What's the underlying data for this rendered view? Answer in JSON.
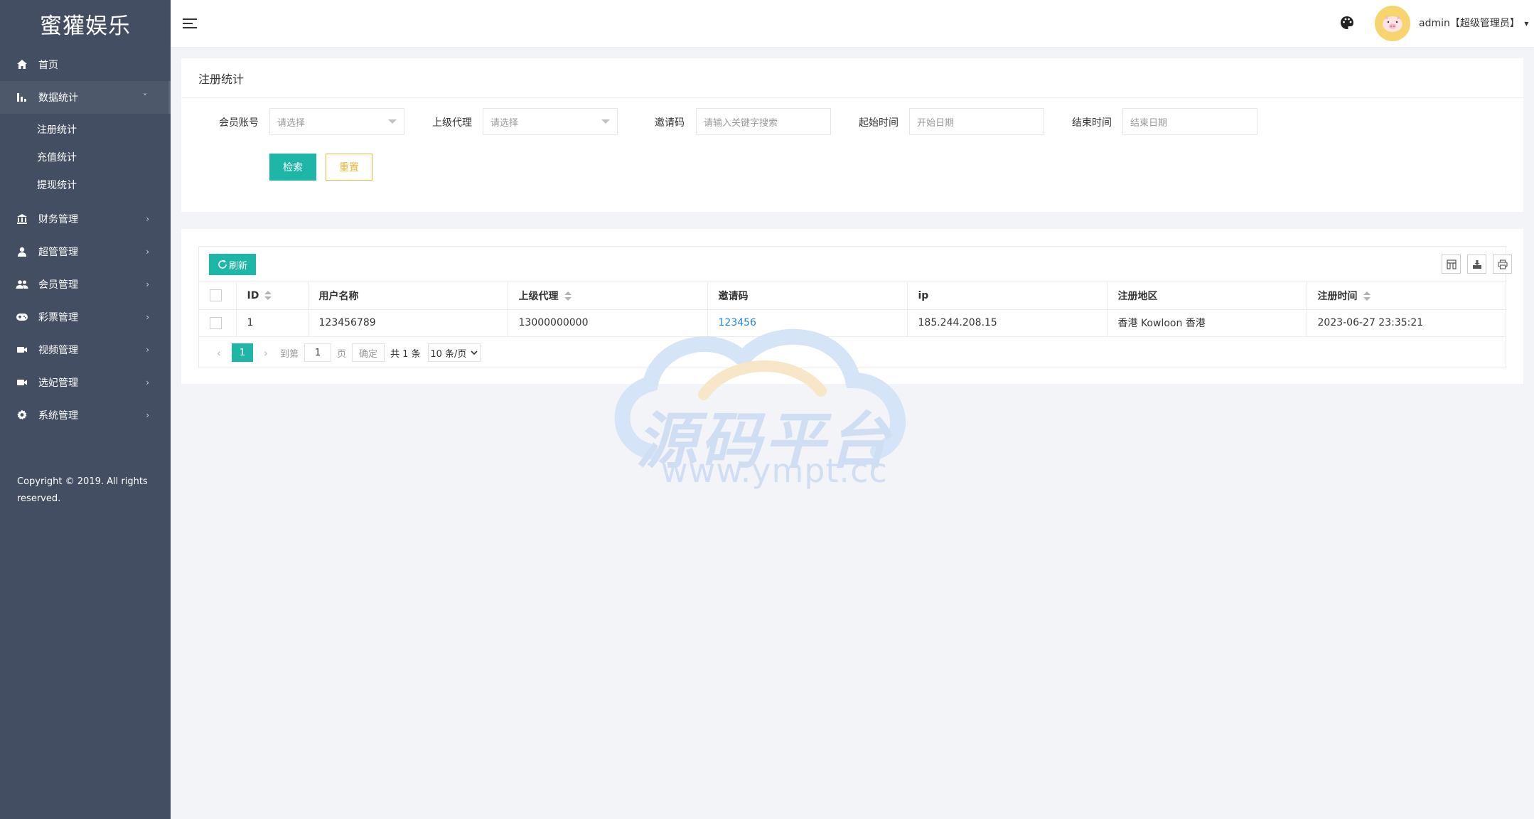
{
  "brand": {
    "name": "蜜獾娱乐"
  },
  "sidebar": {
    "items": [
      {
        "label": "首页",
        "icon": "home-icon"
      },
      {
        "label": "数据统计",
        "icon": "bar-chart-icon",
        "arrow": "˅",
        "open": true,
        "children": [
          {
            "label": "注册统计"
          },
          {
            "label": "充值统计"
          },
          {
            "label": "提现统计"
          }
        ]
      },
      {
        "label": "财务管理",
        "icon": "bank-icon",
        "arrow": "›"
      },
      {
        "label": "超管管理",
        "icon": "user-icon",
        "arrow": "›"
      },
      {
        "label": "会员管理",
        "icon": "users-icon",
        "arrow": "›"
      },
      {
        "label": "彩票管理",
        "icon": "gamepad-icon",
        "arrow": "›"
      },
      {
        "label": "视频管理",
        "icon": "video-icon",
        "arrow": "›"
      },
      {
        "label": "选妃管理",
        "icon": "camera-icon",
        "arrow": "›"
      },
      {
        "label": "系统管理",
        "icon": "gear-icon",
        "arrow": "›"
      }
    ],
    "copyright": "Copyright © 2019. All rights reserved."
  },
  "header": {
    "user_label": "admin【超级管理员】",
    "user_caret": "▾"
  },
  "search": {
    "title": "注册统计",
    "fields": [
      {
        "label": "会员账号",
        "placeholder": "请选择",
        "type": "select"
      },
      {
        "label": "上级代理",
        "placeholder": "请选择",
        "type": "select"
      },
      {
        "label": "邀请码",
        "placeholder": "请输入关键字搜索",
        "type": "text"
      },
      {
        "label": "起始时间",
        "placeholder": "开始日期",
        "type": "date"
      },
      {
        "label": "结束时间",
        "placeholder": "结束日期",
        "type": "date"
      }
    ],
    "search_label": "检索",
    "reset_label": "重置"
  },
  "table": {
    "refresh_label": "刷新",
    "columns": [
      "ID",
      "用户名称",
      "上级代理",
      "邀请码",
      "ip",
      "注册地区",
      "注册时间"
    ],
    "rows": [
      {
        "id": "1",
        "username": "123456789",
        "agent": "13000000000",
        "invite": "123456",
        "ip": "185.244.208.15",
        "region": "香港 Kowloon 香港",
        "time": "2023-06-27 23:35:21"
      }
    ]
  },
  "pager": {
    "prev": "‹",
    "next": "›",
    "current": "1",
    "goto_label": "到第",
    "goto_value": "1",
    "page_label": "页",
    "confirm_label": "确定",
    "total_label": "共 1 条",
    "page_size": "10 条/页"
  },
  "watermark": {
    "title": "源码平台",
    "url": "www.ympt.cc"
  },
  "colors": {
    "sidebar": "#434e62",
    "accent": "#1eb6a6",
    "reset": "#e4b83a",
    "link": "#1e88e5"
  }
}
